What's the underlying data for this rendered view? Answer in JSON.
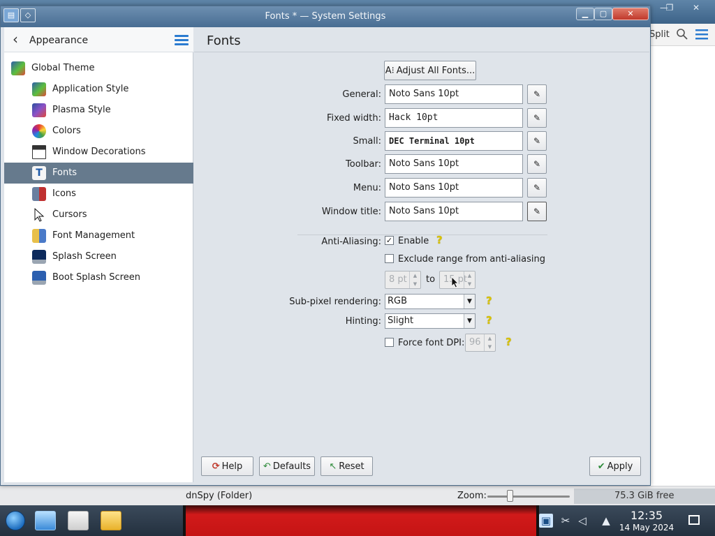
{
  "background_window": {
    "toolbar": {
      "split_label": "Split",
      "search_icon": "search-icon",
      "menu_icon": "hamburger-menu-icon"
    },
    "statusbar": {
      "folder_text": "dnSpy (Folder)",
      "zoom_label": "Zoom:",
      "free_space": "75.3 GiB free"
    }
  },
  "window": {
    "title": "Fonts * — System Settings",
    "controls": [
      "minimize",
      "maximize",
      "close"
    ]
  },
  "sidebar": {
    "back_icon": "back-arrow-icon",
    "title": "Appearance",
    "menu_icon": "hamburger-menu-icon",
    "items": [
      {
        "label": "Global Theme",
        "icon": "global-theme-icon"
      },
      {
        "label": "Application Style",
        "icon": "application-style-icon"
      },
      {
        "label": "Plasma Style",
        "icon": "plasma-style-icon"
      },
      {
        "label": "Colors",
        "icon": "colors-icon"
      },
      {
        "label": "Window Decorations",
        "icon": "window-decorations-icon"
      },
      {
        "label": "Fonts",
        "icon": "fonts-icon",
        "selected": true
      },
      {
        "label": "Icons",
        "icon": "icons-icon"
      },
      {
        "label": "Cursors",
        "icon": "cursors-icon"
      },
      {
        "label": "Font Management",
        "icon": "font-management-icon"
      },
      {
        "label": "Splash Screen",
        "icon": "splash-screen-icon"
      },
      {
        "label": "Boot Splash Screen",
        "icon": "boot-splash-screen-icon"
      }
    ]
  },
  "main": {
    "title": "Fonts",
    "adjust_all_label": "Adjust All Fonts...",
    "fonts": [
      {
        "label": "General:",
        "value": "Noto Sans 10pt"
      },
      {
        "label": "Fixed width:",
        "value": "Hack 10pt"
      },
      {
        "label": "Small:",
        "value": "DEC Terminal 10pt"
      },
      {
        "label": "Toolbar:",
        "value": "Noto Sans 10pt"
      },
      {
        "label": "Menu:",
        "value": "Noto Sans 10pt"
      },
      {
        "label": "Window title:",
        "value": "Noto Sans 10pt"
      }
    ],
    "anti_aliasing": {
      "label": "Anti-Aliasing:",
      "enable_label": "Enable",
      "enabled": true,
      "exclude_label": "Exclude range from anti-aliasing",
      "exclude_checked": false,
      "range_from": "8 pt",
      "range_to_label": "to",
      "range_to": "15 pt"
    },
    "subpixel": {
      "label": "Sub-pixel rendering:",
      "value": "RGB"
    },
    "hinting": {
      "label": "Hinting:",
      "value": "Slight"
    },
    "force_dpi": {
      "label": "Force font DPI:",
      "checked": false,
      "value": "96"
    }
  },
  "footer": {
    "help_label": "Help",
    "defaults_label": "Defaults",
    "reset_label": "Reset",
    "apply_label": "Apply"
  },
  "taskbar": {
    "clock_time": "12:35",
    "clock_date": "14 May 2024"
  }
}
